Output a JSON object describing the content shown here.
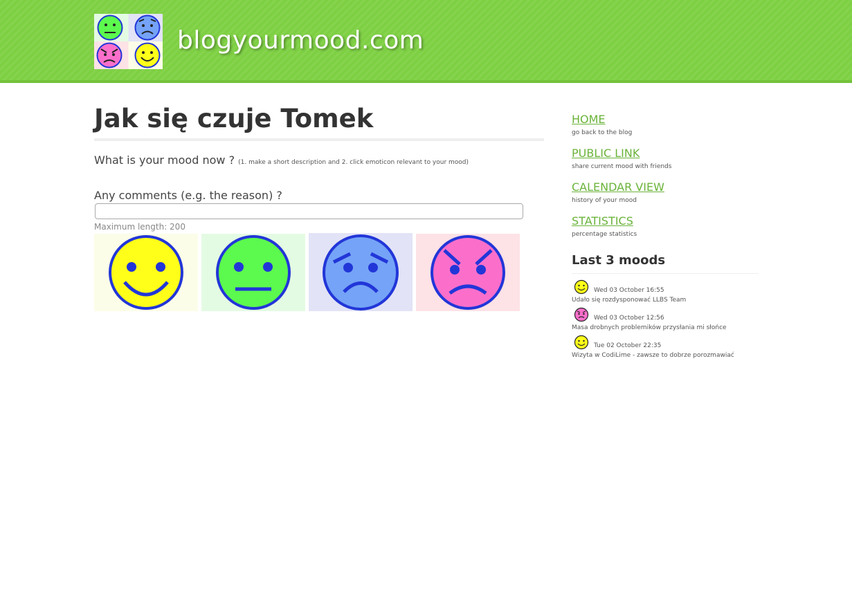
{
  "site": {
    "title": "blogyourmood.com"
  },
  "page": {
    "title": "Jak się czuje Tomek",
    "prompt": "What is your mood now ?",
    "prompt_hint": "(1. make a short description and 2. click emoticon relevant to your mood)",
    "comments_label": "Any comments (e.g. the reason) ?",
    "comment_value": "",
    "max_length": "Maximum length: 200"
  },
  "moods": [
    {
      "name": "happy",
      "icon": "happy-face-icon",
      "face": "#ffff1a",
      "bg": "#fcfde8"
    },
    {
      "name": "neutral",
      "icon": "neutral-face-icon",
      "face": "#5cf94e",
      "bg": "#e4fbe3"
    },
    {
      "name": "sad",
      "icon": "sad-face-icon",
      "face": "#75a3f7",
      "bg": "#e2e3f6"
    },
    {
      "name": "angry",
      "icon": "angry-face-icon",
      "face": "#fb6fcb",
      "bg": "#fde2e6"
    }
  ],
  "colors": {
    "header_green": "#7ed043",
    "link_green": "#6ab33a",
    "face_outline": "#2236d8"
  },
  "sidebar": {
    "nav": [
      {
        "label": "HOME",
        "desc": "go back to the blog"
      },
      {
        "label": "PUBLIC LINK",
        "desc": "share current mood with friends"
      },
      {
        "label": "CALENDAR VIEW",
        "desc": "history of your mood"
      },
      {
        "label": "STATISTICS",
        "desc": "percentage statistics"
      }
    ],
    "last_title": "Last 3 moods",
    "entries": [
      {
        "mood": "happy",
        "date": "Wed 03 October 16:55",
        "text": "Udało się rozdysponować LLBS Team"
      },
      {
        "mood": "angry",
        "date": "Wed 03 October 12:56",
        "text": "Masa drobnych problemików przysłania mi słońce"
      },
      {
        "mood": "happy",
        "date": "Tue 02 October 22:35",
        "text": "Wizyta w CodiLime - zawsze to dobrze porozmawiać"
      }
    ]
  }
}
